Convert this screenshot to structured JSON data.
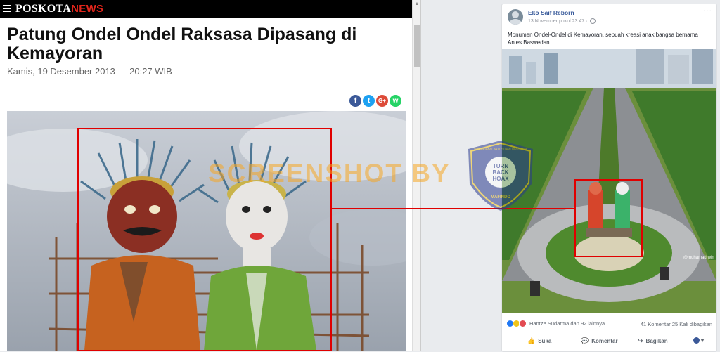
{
  "left": {
    "brand_main": "POSKOTA",
    "brand_news": "NEWS",
    "headline": "Patung Ondel Ondel Raksasa Dipasang di Kemayoran",
    "dateline": "Kamis, 19 Desember 2013 — 20:27 WIB",
    "share": [
      "f",
      "t",
      "G+",
      "w"
    ]
  },
  "post": {
    "author": "Eko Saif Reborn",
    "time": "13 November pukul 23.47 · ",
    "more": "···",
    "caption": "Monumen Ondel-Ondel di Kemayoran, sebuah kreasi anak bangsa bernama Anies Baswedan.",
    "photo_credit": "@muhamadrwin",
    "reactions_text": "Hantze Sudarma dan 92 lainnya",
    "counts_text": "41 Komentar  25 Kali dibagikan",
    "actions": {
      "like": "Suka",
      "comment": "Komentar",
      "share": "Bagikan"
    }
  },
  "watermark": {
    "text": "SCREENSHOT BY",
    "badge_top": "TURN",
    "badge_mid": "BACK",
    "badge_bottom": "HOAX",
    "ring_text": "MASYARAKAT ANTI FITNAH INDONESIA",
    "ring_bottom": "MAFINDO"
  },
  "colors": {
    "accent_red": "#e0251b",
    "fb_blue": "#365899",
    "annotation": "#e00000",
    "watermark": "#f5a623"
  }
}
